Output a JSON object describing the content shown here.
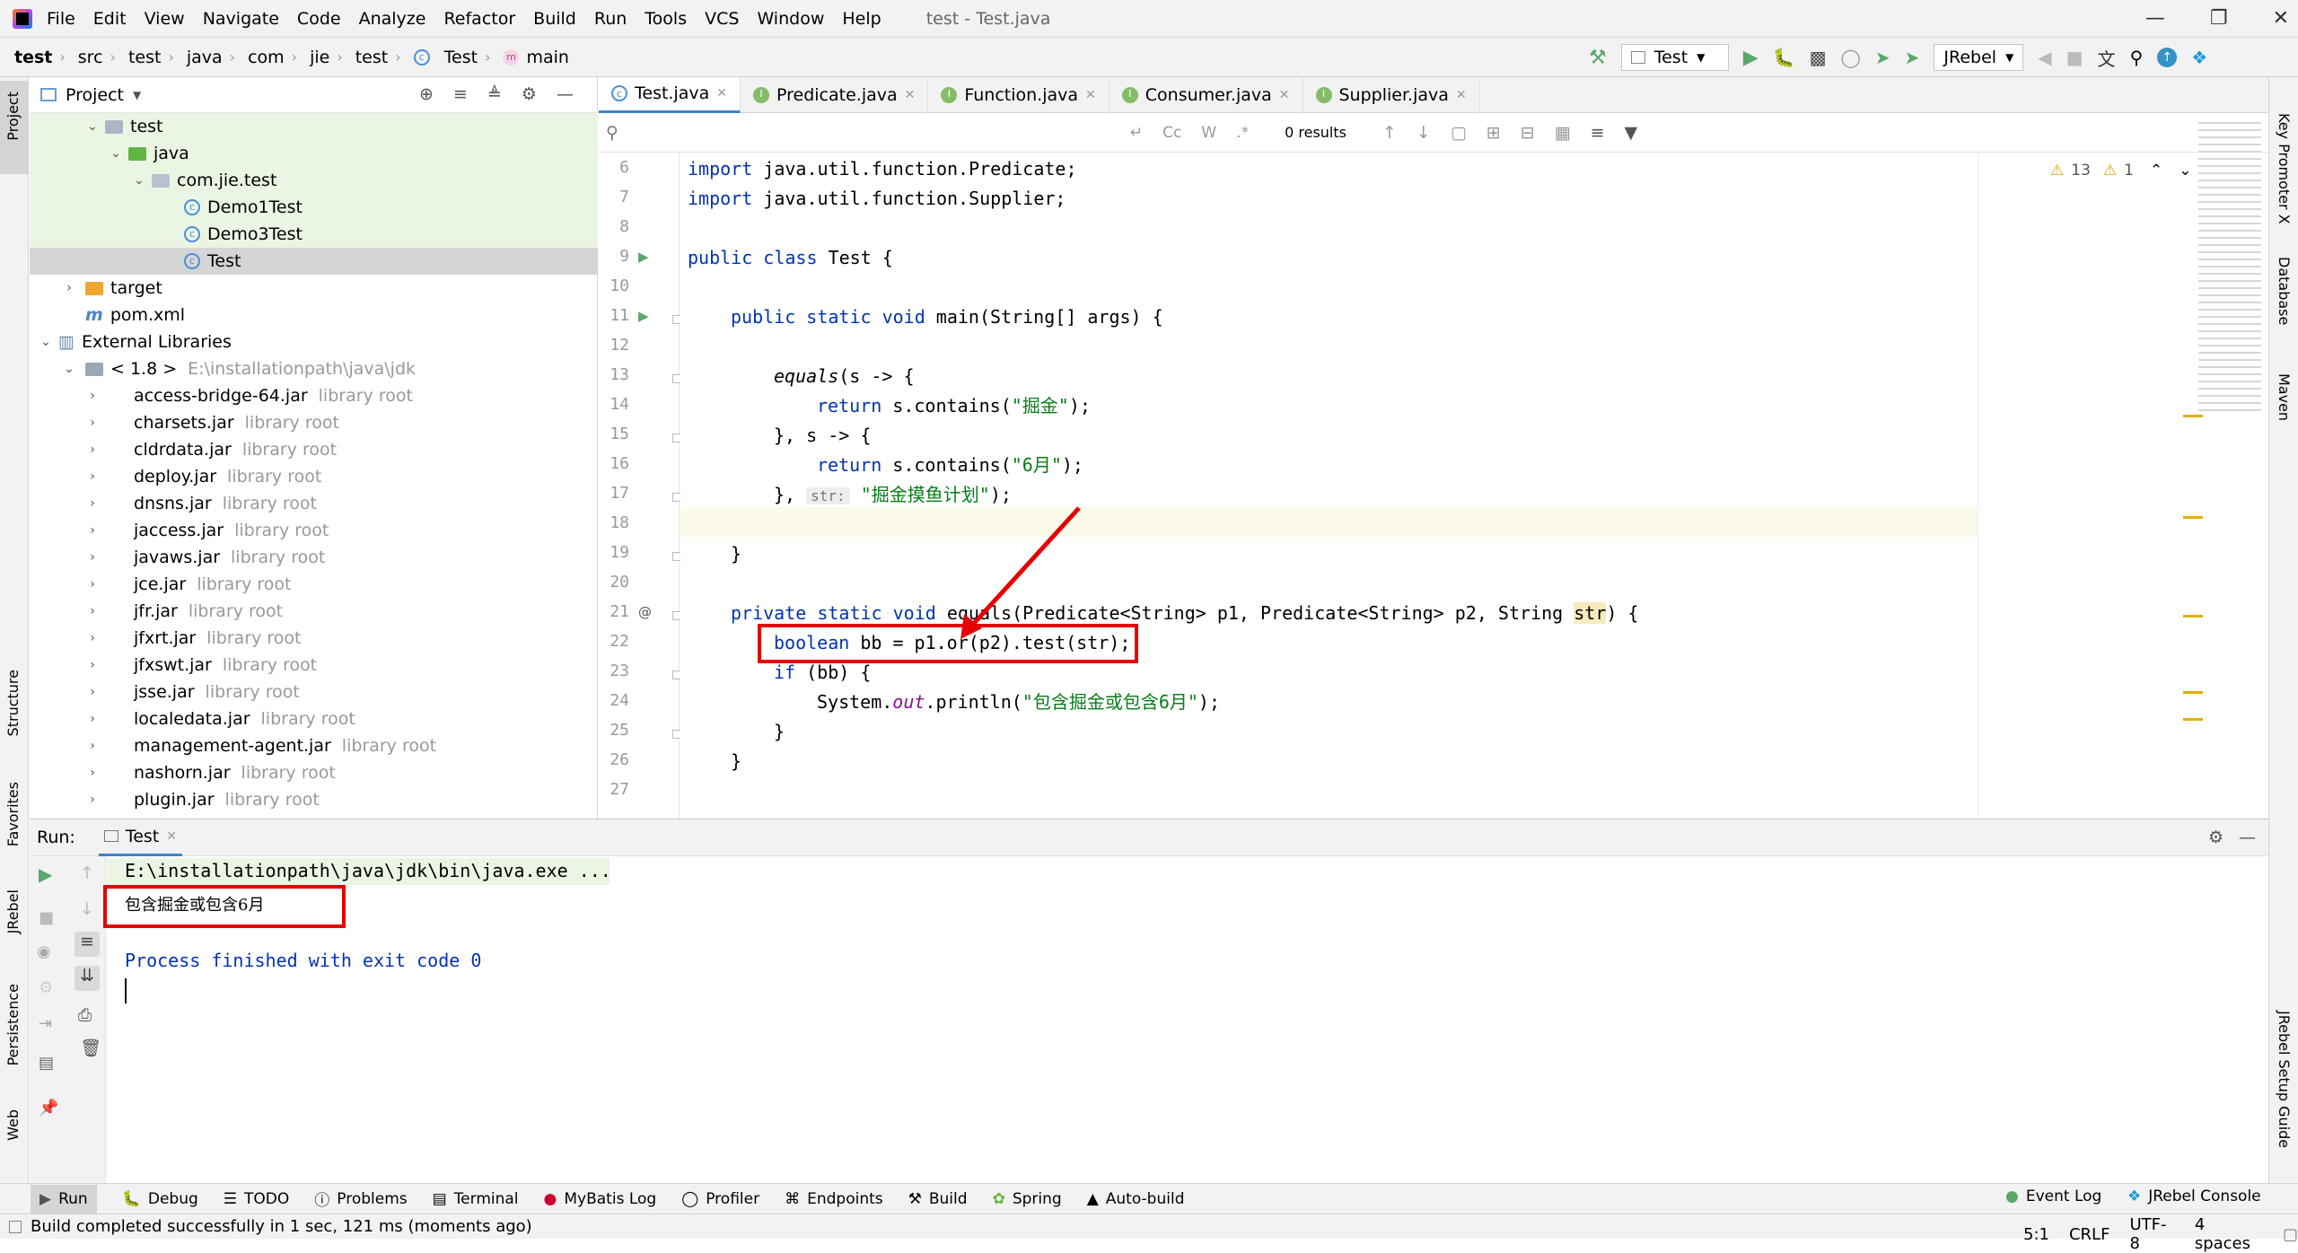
{
  "menu": [
    "File",
    "Edit",
    "View",
    "Navigate",
    "Code",
    "Analyze",
    "Refactor",
    "Build",
    "Run",
    "Tools",
    "VCS",
    "Window",
    "Help"
  ],
  "window_title": "test - Test.java",
  "breadcrumb": [
    "test",
    "src",
    "test",
    "java",
    "com",
    "jie",
    "test",
    "Test",
    "main"
  ],
  "toolbar": {
    "run_config": "Test",
    "jrebel": "JRebel"
  },
  "left_stripe": {
    "project": "Project",
    "structure": "Structure",
    "favorites": "Favorites",
    "jrebel": "JRebel",
    "persistence": "Persistence",
    "web": "Web"
  },
  "right_stripe": {
    "key_promoter": "Key Promoter X",
    "database": "Database",
    "maven": "Maven",
    "jrebel_guide": "JRebel Setup Guide"
  },
  "project": {
    "title": "Project",
    "tree": [
      {
        "label": "test",
        "type": "folder"
      },
      {
        "label": "java",
        "type": "folder-green"
      },
      {
        "label": "com.jie.test",
        "type": "package"
      },
      {
        "label": "Demo1Test",
        "type": "class"
      },
      {
        "label": "Demo3Test",
        "type": "class"
      },
      {
        "label": "Test",
        "type": "class"
      },
      {
        "label": "target",
        "type": "folder-orange"
      },
      {
        "label": "pom.xml",
        "type": "maven"
      },
      {
        "label": "External Libraries",
        "type": "libs"
      },
      {
        "label": "< 1.8 >",
        "extra": "E:\\installationpath\\java\\jdk",
        "type": "jdk"
      },
      {
        "label": "access-bridge-64.jar",
        "extra": "library root"
      },
      {
        "label": "charsets.jar",
        "extra": "library root"
      },
      {
        "label": "cldrdata.jar",
        "extra": "library root"
      },
      {
        "label": "deploy.jar",
        "extra": "library root"
      },
      {
        "label": "dnsns.jar",
        "extra": "library root"
      },
      {
        "label": "jaccess.jar",
        "extra": "library root"
      },
      {
        "label": "javaws.jar",
        "extra": "library root"
      },
      {
        "label": "jce.jar",
        "extra": "library root"
      },
      {
        "label": "jfr.jar",
        "extra": "library root"
      },
      {
        "label": "jfxrt.jar",
        "extra": "library root"
      },
      {
        "label": "jfxswt.jar",
        "extra": "library root"
      },
      {
        "label": "jsse.jar",
        "extra": "library root"
      },
      {
        "label": "localedata.jar",
        "extra": "library root"
      },
      {
        "label": "management-agent.jar",
        "extra": "library root"
      },
      {
        "label": "nashorn.jar",
        "extra": "library root"
      },
      {
        "label": "plugin.jar",
        "extra": "library root"
      }
    ]
  },
  "tabs": [
    "Test.java",
    "Predicate.java",
    "Function.java",
    "Consumer.java",
    "Supplier.java"
  ],
  "find": {
    "results": "0 results",
    "cc": "Cc",
    "w": "W",
    "star": ".*"
  },
  "inspections": {
    "warnings": "13",
    "weak": "1"
  },
  "line_numbers": [
    "6",
    "7",
    "8",
    "9",
    "10",
    "11",
    "12",
    "13",
    "14",
    "15",
    "16",
    "17",
    "18",
    "19",
    "20",
    "21",
    "22",
    "23",
    "24",
    "25",
    "26",
    "27"
  ],
  "code": {
    "l6a": "import",
    "l6b": " java.util.function.Predicate;",
    "l7a": "import",
    "l7b": " java.util.function.Supplier;",
    "l9a": "public class",
    "l9b": " Test {",
    "l11a": "public static void",
    "l11b": " main(String[] args) {",
    "l13a": "equals",
    "l13b": "(s -> {",
    "l14a": "return",
    "l14b": " s.contains(",
    "l14c": "\"掘金\"",
    "l14d": ");",
    "l15": "}, s -> {",
    "l16a": "return",
    "l16b": " s.contains(",
    "l16c": "\"6月\"",
    "l16d": ");",
    "l17a": "},",
    "l17h": "str:",
    "l17c": "\"掘金摸鱼计划\"",
    "l17d": ");",
    "l19": "}",
    "l21a": "private static void",
    "l21b": " equals(Predicate<String> p1, Predicate<String> p2, String ",
    "l21c": "str",
    "l21d": ") {",
    "l22a": "boolean",
    "l22b": " bb = p1.or(p2).test(str);",
    "l23a": "if",
    "l23b": " (bb) {",
    "l24a": "System.",
    "l24b": "out",
    "l24c": ".println(",
    "l24d": "\"包含掘金或包含6月\"",
    "l24e": ");",
    "l25": "}",
    "l26": "}"
  },
  "run": {
    "label": "Run:",
    "tab": "Test",
    "cmd": "E:\\installationpath\\java\\jdk\\bin\\java.exe ...",
    "out": "包含掘金或包含6月",
    "finish": "Process finished with exit code 0"
  },
  "bottom_tools": [
    "Run",
    "Debug",
    "TODO",
    "Problems",
    "Terminal",
    "MyBatis Log",
    "Profiler",
    "Endpoints",
    "Build",
    "Spring",
    "Auto-build"
  ],
  "bottom_right": [
    "Event Log",
    "JRebel Console"
  ],
  "status": {
    "message": "Build completed successfully in 1 sec, 121 ms (moments ago)",
    "pos": "5:1",
    "eol": "CRLF",
    "enc": "UTF-8",
    "indent": "4 spaces"
  },
  "colors": {
    "keyword": "#0033b3",
    "string": "#067d17",
    "static_field": "#871094",
    "annotation_red": "#e80000",
    "current_line": "#fcfae8"
  }
}
